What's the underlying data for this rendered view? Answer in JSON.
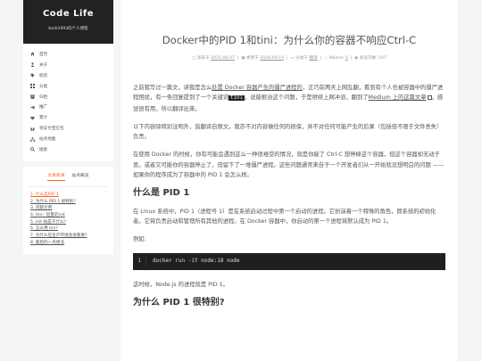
{
  "site": {
    "title": "Code Life",
    "subtitle": "borb1993的个人博客"
  },
  "menu": [
    {
      "label": "首页",
      "icon": "home-icon"
    },
    {
      "label": "关于",
      "icon": "user-icon"
    },
    {
      "label": "标签",
      "icon": "tags-icon"
    },
    {
      "label": "分类",
      "icon": "th-icon"
    },
    {
      "label": "归档",
      "icon": "archive-icon"
    },
    {
      "label": "推广",
      "icon": "bullhorn-icon"
    },
    {
      "label": "累计",
      "icon": "heartbeat-icon"
    },
    {
      "label": "领支付宝红包",
      "icon": "gift-icon"
    },
    {
      "label": "站点地图",
      "icon": "sitemap-icon"
    },
    {
      "label": "搜索",
      "icon": "search-icon"
    }
  ],
  "toc": {
    "tab_active": "文章目录",
    "tab_other": "站点概览",
    "items": [
      "1. 什么是PID 1",
      "2. 为什么 PID 1 很特别?",
      "3. 问题示例",
      "4. tini：轻量的init",
      "5. init 执是干什么?",
      "6. 怎么用 tini?",
      "7. 为什么在生产环境会很重要?",
      "8. 最后的一点想法"
    ]
  },
  "post": {
    "title": "Docker中的PID 1和tini：为什么你的容器不响应Ctrl-C",
    "meta": {
      "posted_label": "发表于",
      "posted_date": "2025-06-07",
      "updated_label": "更新于",
      "updated_date": "2026-09-19",
      "category_label": "分类于",
      "category": "翻译",
      "comments_label": "Waline:",
      "comments": "0",
      "views_label": "阅读次数:",
      "views": "547"
    },
    "p1a": "之前我写过一篇文，讲我是怎么",
    "p1link1": "处置 Docker 容器产生的僵尸进程的",
    "p1b": "，正巧前两天上网乱翻，看到有个人也被容器中的僵尸进程困扰，有一条回复提到了一个关键词",
    "p1code": "tini",
    "p1c": "，说能根治这个问题，于是继续上网冲浪，翻到了",
    "p1link2": "Medium 上的这篇文章",
    "p1d": "，感觉很有用，所以翻译出来。",
    "p2": "以下内容除特别注明外，皆翻译自原文。我亦不对内容做任何的担保，并不对任何可能产生的后果（包括但不限于文件丢失）负责。",
    "p3": "在使用 Docker 的时候，你有可能会遇到这么一种很难受的情况，就是你敲了 Ctrl-C 想停掉这个容器，但这个容器却无动于衷。或者又可能你的容器停止了，但留下了一堆僵尸进程。这些问题通常来自于一个开发者们从一开始就没想明白的问题 —— 如果你的程序成为了容器中的 PID 1 会怎么样。",
    "h1": "什么是 PID 1",
    "p4": "在 Linux 系统中，PID 1（进程号 1）是在系统启动过程中第一个启动的进程。它扮演着一个特殊的角色，即系统的初始化者。它将负责启动和管理所有其他的进程。在 Docker 容器中，你启动的第一个进程将默认成为 PID 1。",
    "p5": "例如:",
    "code_line_no": "1",
    "code": "docker run -it node:18 node",
    "p6": "这时候，Node.js 的进程就是 PID 1。",
    "h2": "为什么 PID 1 很特别?"
  }
}
